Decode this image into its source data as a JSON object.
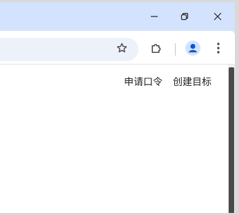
{
  "window_controls": {
    "minimize": "minimize-icon",
    "restore": "restore-icon",
    "close": "close-icon"
  },
  "toolbar": {
    "bookmark_icon": "star-outline-icon",
    "extensions_icon": "puzzle-icon",
    "profile_icon": "profile-avatar-icon",
    "menu_icon": "kebab-menu-icon"
  },
  "page": {
    "links": [
      {
        "label": "申请口令"
      },
      {
        "label": "创建目标"
      }
    ]
  },
  "colors": {
    "titlebar": "#d3e3fd",
    "omnibox": "#edf2fa",
    "profile_accent": "#0b57d0",
    "scroll_thumb": "#4a4a4a"
  }
}
